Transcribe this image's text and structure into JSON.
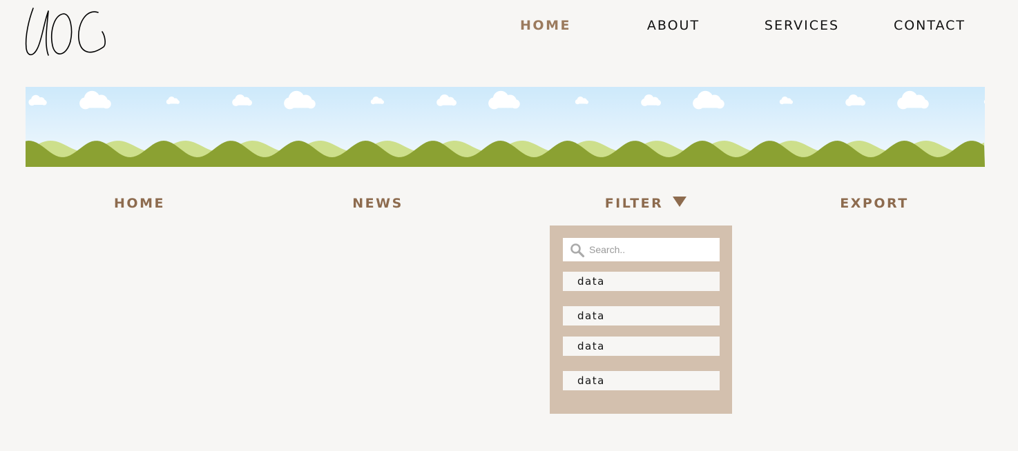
{
  "logo": {
    "text": "UOC"
  },
  "top_nav": {
    "items": [
      {
        "label": "HOME",
        "active": true
      },
      {
        "label": "ABOUT"
      },
      {
        "label": "SERVICES"
      },
      {
        "label": "CONTACT"
      }
    ]
  },
  "sub_nav": {
    "home_label": "HOME",
    "news_label": "NEWS",
    "filter_label": "FILTER",
    "export_label": "EXPORT"
  },
  "dropdown": {
    "search": {
      "placeholder": "Search.."
    },
    "options": [
      {
        "label": "data"
      },
      {
        "label": "data"
      },
      {
        "label": "data"
      },
      {
        "label": "data"
      }
    ]
  },
  "colors": {
    "background": "#f7f6f4",
    "accent": "#8d6b4e",
    "active_nav": "#9b7a5d",
    "dropdown_bg": "#d3c0ae",
    "sky_top": "#cde9fb",
    "hill_dark": "#8ba132",
    "hill_light": "#cddf8b"
  },
  "icons": [
    "search-icon",
    "caret-down-icon"
  ]
}
